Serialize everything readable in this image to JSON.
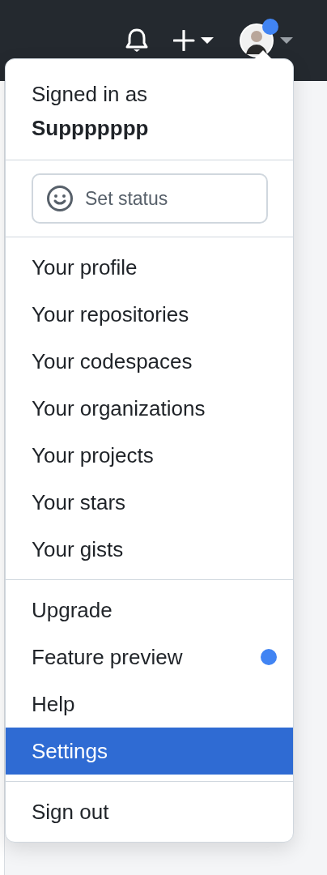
{
  "header": {
    "avatar": {
      "notification_dot": true
    }
  },
  "menu": {
    "signed_in_label": "Signed in as",
    "username": "Suppppppp",
    "status_button": {
      "label": "Set status"
    },
    "sections": [
      {
        "items": [
          {
            "label": "Your profile",
            "selected": false
          },
          {
            "label": "Your repositories",
            "selected": false
          },
          {
            "label": "Your codespaces",
            "selected": false
          },
          {
            "label": "Your organizations",
            "selected": false
          },
          {
            "label": "Your projects",
            "selected": false
          },
          {
            "label": "Your stars",
            "selected": false
          },
          {
            "label": "Your gists",
            "selected": false
          }
        ]
      },
      {
        "items": [
          {
            "label": "Upgrade",
            "selected": false
          },
          {
            "label": "Feature preview",
            "selected": false,
            "color": "#4184f3"
          },
          {
            "label": "Help",
            "selected": false
          },
          {
            "label": "Settings",
            "selected": true
          }
        ]
      },
      {
        "items": [
          {
            "label": "Sign out",
            "selected": false
          }
        ]
      }
    ]
  }
}
